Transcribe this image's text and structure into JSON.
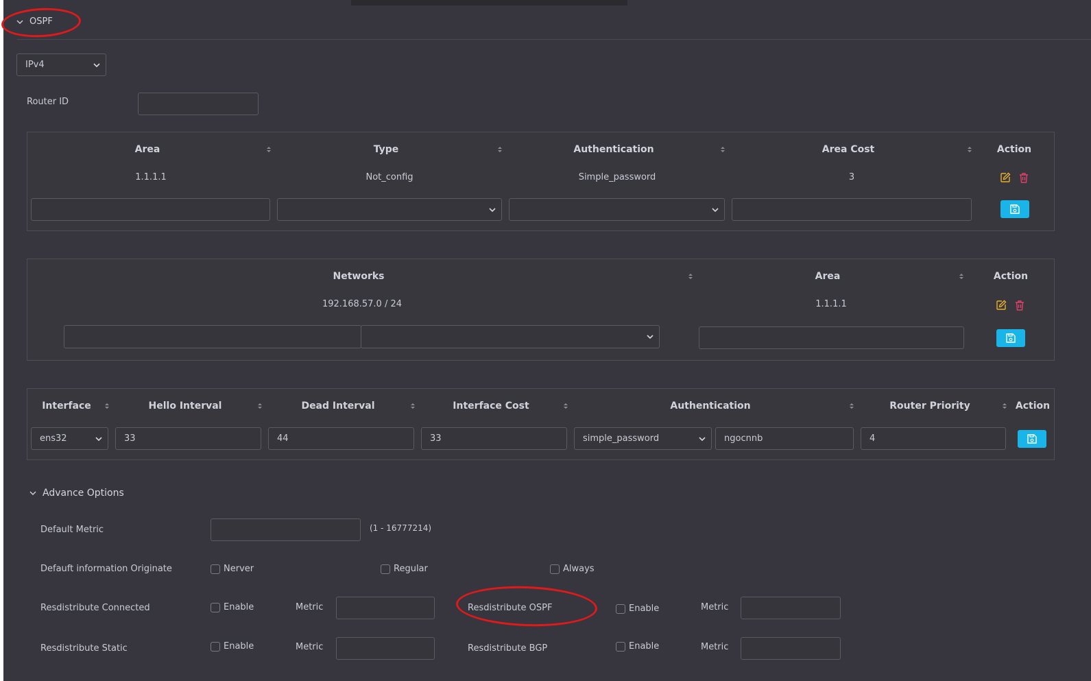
{
  "ospf_section": {
    "title": "OSPF"
  },
  "ip_version": {
    "value": "IPv4"
  },
  "router_id": {
    "label": "Router ID",
    "value": ""
  },
  "area_table": {
    "headers": [
      "Area",
      "Type",
      "Authentication",
      "Area Cost",
      "Action"
    ],
    "rows": [
      {
        "area": "1.1.1.1",
        "type": "Not_config",
        "authentication": "Simple_password",
        "area_cost": "3"
      }
    ]
  },
  "networks_table": {
    "headers": [
      "Networks",
      "Area",
      "Action"
    ],
    "rows": [
      {
        "network": "192.168.57.0 / 24",
        "area": "1.1.1.1"
      }
    ]
  },
  "interface_table": {
    "headers": [
      "Interface",
      "Hello Interval",
      "Dead Interval",
      "Interface Cost",
      "Authentication",
      "Router Priority",
      "Action"
    ],
    "row": {
      "interface": "ens32",
      "hello_interval": "33",
      "dead_interval": "44",
      "interface_cost": "33",
      "authentication": "simple_password",
      "auth_key": "ngocnnb",
      "router_priority": "4"
    }
  },
  "advance": {
    "title": "Advance Options",
    "default_metric": {
      "label": "Default Metric",
      "value": "",
      "range": "(1 - 16777214)"
    },
    "default_info_originate": {
      "label": "Defauft information Originate",
      "options": [
        "Nerver",
        "Regular",
        "Always"
      ]
    },
    "redistribute_connected": {
      "label": "Resdistribute Connected",
      "enable": "Enable",
      "metric": "Metric"
    },
    "redistribute_ospf": {
      "label": "Resdistribute OSPF",
      "enable": "Enable",
      "metric": "Metric"
    },
    "redistribute_static": {
      "label": "Resdistribute Static",
      "enable": "Enable",
      "metric": "Metric"
    },
    "redistribute_bgp": {
      "label": "Resdistribute BGP",
      "enable": "Enable",
      "metric": "Metric"
    }
  },
  "colors": {
    "background": "#37363e",
    "accent": "#19b4e8",
    "edit": "#e8b12a",
    "delete": "#e0406a",
    "annotation": "#e01a1a"
  },
  "icons": {
    "edit": "edit-icon",
    "delete": "trash-icon",
    "save": "save-icon",
    "chevron": "chevron-down-icon"
  }
}
